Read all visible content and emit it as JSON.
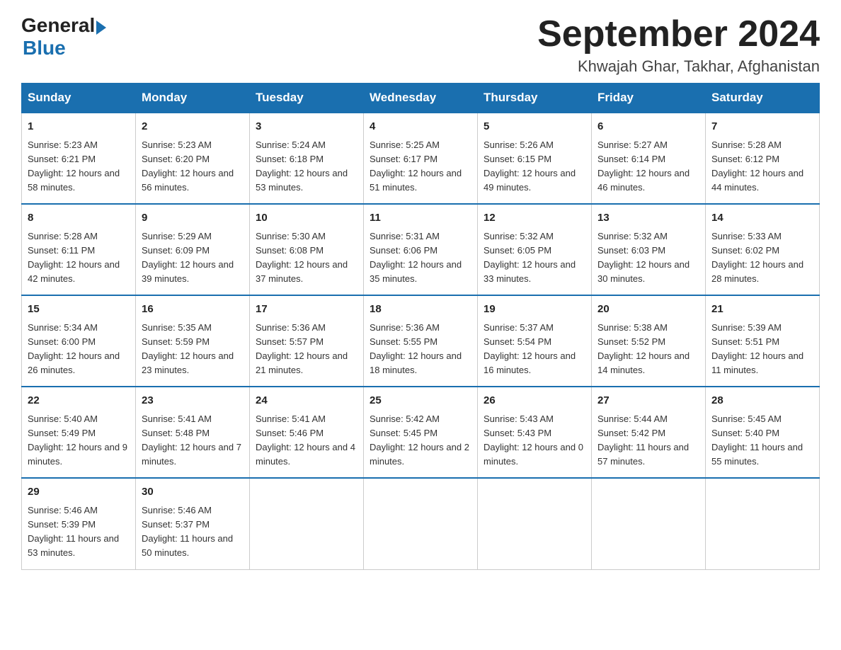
{
  "header": {
    "logo_general": "General",
    "logo_blue": "Blue",
    "month_title": "September 2024",
    "location": "Khwajah Ghar, Takhar, Afghanistan"
  },
  "weekdays": [
    "Sunday",
    "Monday",
    "Tuesday",
    "Wednesday",
    "Thursday",
    "Friday",
    "Saturday"
  ],
  "weeks": [
    [
      {
        "day": "1",
        "sunrise": "5:23 AM",
        "sunset": "6:21 PM",
        "daylight": "12 hours and 58 minutes."
      },
      {
        "day": "2",
        "sunrise": "5:23 AM",
        "sunset": "6:20 PM",
        "daylight": "12 hours and 56 minutes."
      },
      {
        "day": "3",
        "sunrise": "5:24 AM",
        "sunset": "6:18 PM",
        "daylight": "12 hours and 53 minutes."
      },
      {
        "day": "4",
        "sunrise": "5:25 AM",
        "sunset": "6:17 PM",
        "daylight": "12 hours and 51 minutes."
      },
      {
        "day": "5",
        "sunrise": "5:26 AM",
        "sunset": "6:15 PM",
        "daylight": "12 hours and 49 minutes."
      },
      {
        "day": "6",
        "sunrise": "5:27 AM",
        "sunset": "6:14 PM",
        "daylight": "12 hours and 46 minutes."
      },
      {
        "day": "7",
        "sunrise": "5:28 AM",
        "sunset": "6:12 PM",
        "daylight": "12 hours and 44 minutes."
      }
    ],
    [
      {
        "day": "8",
        "sunrise": "5:28 AM",
        "sunset": "6:11 PM",
        "daylight": "12 hours and 42 minutes."
      },
      {
        "day": "9",
        "sunrise": "5:29 AM",
        "sunset": "6:09 PM",
        "daylight": "12 hours and 39 minutes."
      },
      {
        "day": "10",
        "sunrise": "5:30 AM",
        "sunset": "6:08 PM",
        "daylight": "12 hours and 37 minutes."
      },
      {
        "day": "11",
        "sunrise": "5:31 AM",
        "sunset": "6:06 PM",
        "daylight": "12 hours and 35 minutes."
      },
      {
        "day": "12",
        "sunrise": "5:32 AM",
        "sunset": "6:05 PM",
        "daylight": "12 hours and 33 minutes."
      },
      {
        "day": "13",
        "sunrise": "5:32 AM",
        "sunset": "6:03 PM",
        "daylight": "12 hours and 30 minutes."
      },
      {
        "day": "14",
        "sunrise": "5:33 AM",
        "sunset": "6:02 PM",
        "daylight": "12 hours and 28 minutes."
      }
    ],
    [
      {
        "day": "15",
        "sunrise": "5:34 AM",
        "sunset": "6:00 PM",
        "daylight": "12 hours and 26 minutes."
      },
      {
        "day": "16",
        "sunrise": "5:35 AM",
        "sunset": "5:59 PM",
        "daylight": "12 hours and 23 minutes."
      },
      {
        "day": "17",
        "sunrise": "5:36 AM",
        "sunset": "5:57 PM",
        "daylight": "12 hours and 21 minutes."
      },
      {
        "day": "18",
        "sunrise": "5:36 AM",
        "sunset": "5:55 PM",
        "daylight": "12 hours and 18 minutes."
      },
      {
        "day": "19",
        "sunrise": "5:37 AM",
        "sunset": "5:54 PM",
        "daylight": "12 hours and 16 minutes."
      },
      {
        "day": "20",
        "sunrise": "5:38 AM",
        "sunset": "5:52 PM",
        "daylight": "12 hours and 14 minutes."
      },
      {
        "day": "21",
        "sunrise": "5:39 AM",
        "sunset": "5:51 PM",
        "daylight": "12 hours and 11 minutes."
      }
    ],
    [
      {
        "day": "22",
        "sunrise": "5:40 AM",
        "sunset": "5:49 PM",
        "daylight": "12 hours and 9 minutes."
      },
      {
        "day": "23",
        "sunrise": "5:41 AM",
        "sunset": "5:48 PM",
        "daylight": "12 hours and 7 minutes."
      },
      {
        "day": "24",
        "sunrise": "5:41 AM",
        "sunset": "5:46 PM",
        "daylight": "12 hours and 4 minutes."
      },
      {
        "day": "25",
        "sunrise": "5:42 AM",
        "sunset": "5:45 PM",
        "daylight": "12 hours and 2 minutes."
      },
      {
        "day": "26",
        "sunrise": "5:43 AM",
        "sunset": "5:43 PM",
        "daylight": "12 hours and 0 minutes."
      },
      {
        "day": "27",
        "sunrise": "5:44 AM",
        "sunset": "5:42 PM",
        "daylight": "11 hours and 57 minutes."
      },
      {
        "day": "28",
        "sunrise": "5:45 AM",
        "sunset": "5:40 PM",
        "daylight": "11 hours and 55 minutes."
      }
    ],
    [
      {
        "day": "29",
        "sunrise": "5:46 AM",
        "sunset": "5:39 PM",
        "daylight": "11 hours and 53 minutes."
      },
      {
        "day": "30",
        "sunrise": "5:46 AM",
        "sunset": "5:37 PM",
        "daylight": "11 hours and 50 minutes."
      },
      null,
      null,
      null,
      null,
      null
    ]
  ]
}
